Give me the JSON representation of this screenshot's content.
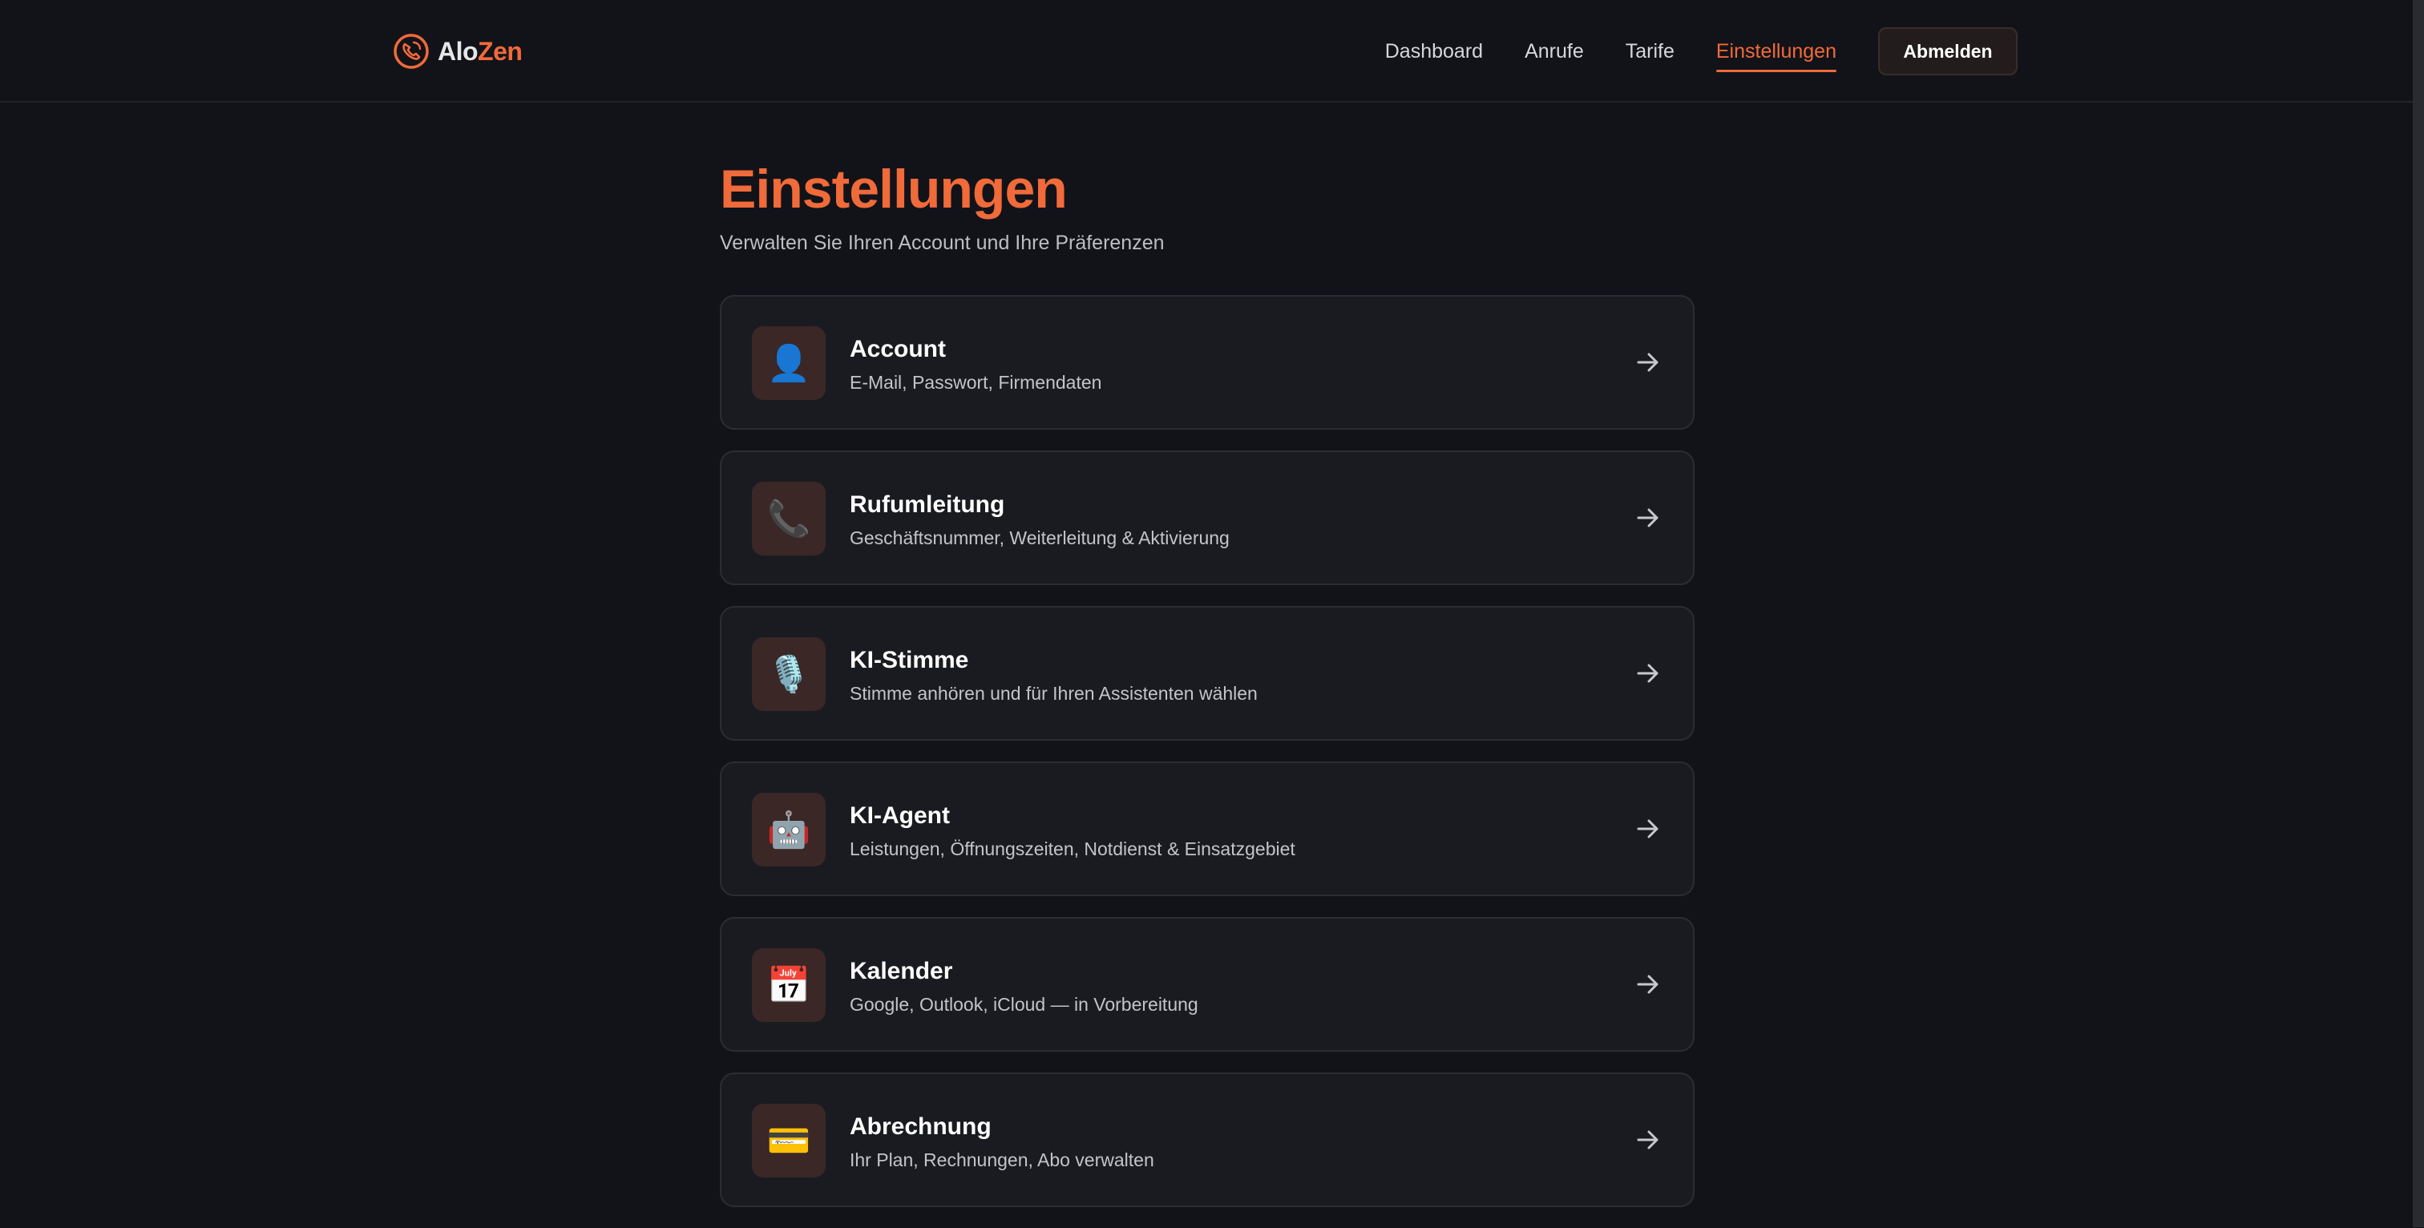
{
  "app": {
    "logo_part1": "Alo",
    "logo_part2": "Zen",
    "accent_color": "#f06a3a"
  },
  "nav": {
    "items": [
      {
        "label": "Dashboard",
        "active": false
      },
      {
        "label": "Anrufe",
        "active": false
      },
      {
        "label": "Tarife",
        "active": false
      },
      {
        "label": "Einstellungen",
        "active": true
      }
    ],
    "logout_label": "Abmelden"
  },
  "page": {
    "title": "Einstellungen",
    "subtitle": "Verwalten Sie Ihren Account und Ihre Präferenzen"
  },
  "settings": [
    {
      "icon": "user-icon",
      "emoji": "👤",
      "title": "Account",
      "desc": "E-Mail, Passwort, Firmendaten"
    },
    {
      "icon": "phone-icon",
      "emoji": "📞",
      "title": "Rufumleitung",
      "desc": "Geschäftsnummer, Weiterleitung & Aktivierung"
    },
    {
      "icon": "microphone-icon",
      "emoji": "🎙️",
      "title": "KI-Stimme",
      "desc": "Stimme anhören und für Ihren Assistenten wählen"
    },
    {
      "icon": "robot-icon",
      "emoji": "🤖",
      "title": "KI-Agent",
      "desc": "Leistungen, Öffnungszeiten, Notdienst & Einsatzgebiet"
    },
    {
      "icon": "calendar-icon",
      "emoji": "📅",
      "title": "Kalender",
      "desc": "Google, Outlook, iCloud — in Vorbereitung"
    },
    {
      "icon": "credit-card-icon",
      "emoji": "💳",
      "title": "Abrechnung",
      "desc": "Ihr Plan, Rechnungen, Abo verwalten"
    }
  ]
}
